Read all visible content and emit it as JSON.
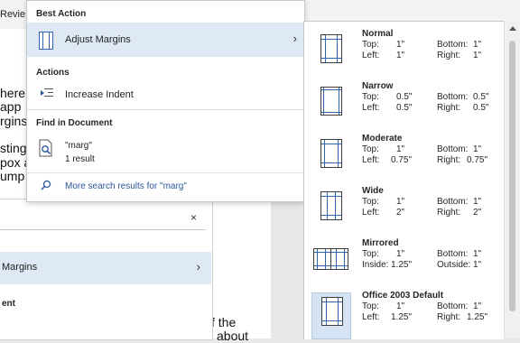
{
  "ribbon": {
    "tab_fragment": "Revie"
  },
  "document": {
    "left_fragments": [
      "here",
      "app",
      "rgins",
      "sting",
      "pox a",
      "ump"
    ],
    "bottom_fragments": [
      "f the",
      "about"
    ]
  },
  "menu": {
    "best_action": {
      "heading": "Best Action",
      "label": "Adjust Margins",
      "icon": "margins-icon"
    },
    "actions": {
      "heading": "Actions",
      "items": [
        {
          "label": "Increase Indent",
          "icon": "increase-indent-icon"
        }
      ]
    },
    "find": {
      "heading": "Find in Document",
      "query": "\"marg\"",
      "results": "1 result",
      "icon": "document-search-icon"
    },
    "more": {
      "label": "More search results for \"marg\"",
      "icon": "search-icon"
    }
  },
  "pane2": {
    "clear_icon": "×",
    "row_label": "Margins",
    "heading": "ent"
  },
  "gallery": {
    "labels": {
      "top": "Top:",
      "bottom": "Bottom:",
      "left": "Left:",
      "right": "Right:",
      "inside": "Inside:",
      "outside": "Outside:"
    },
    "items": [
      {
        "name": "Normal",
        "top": "1\"",
        "bottom": "1\"",
        "left": "1\"",
        "right": "1\""
      },
      {
        "name": "Narrow",
        "top": "0.5\"",
        "bottom": "0.5\"",
        "left": "0.5\"",
        "right": "0.5\""
      },
      {
        "name": "Moderate",
        "top": "1\"",
        "bottom": "1\"",
        "left": "0.75\"",
        "right": "0.75\""
      },
      {
        "name": "Wide",
        "top": "1\"",
        "bottom": "1\"",
        "left": "2\"",
        "right": "2\""
      },
      {
        "name": "Mirrored",
        "top": "1\"",
        "bottom": "1\"",
        "left": "1.25\"",
        "right": "1\"",
        "mirrored": true
      },
      {
        "name": "Office 2003 Default",
        "top": "1\"",
        "bottom": "1\"",
        "left": "1.25\"",
        "right": "1.25\"",
        "selected": true
      }
    ]
  },
  "colors": {
    "accent": "#2b579a",
    "highlight": "#dfe8f5",
    "margin_line": "#2f64b0"
  }
}
